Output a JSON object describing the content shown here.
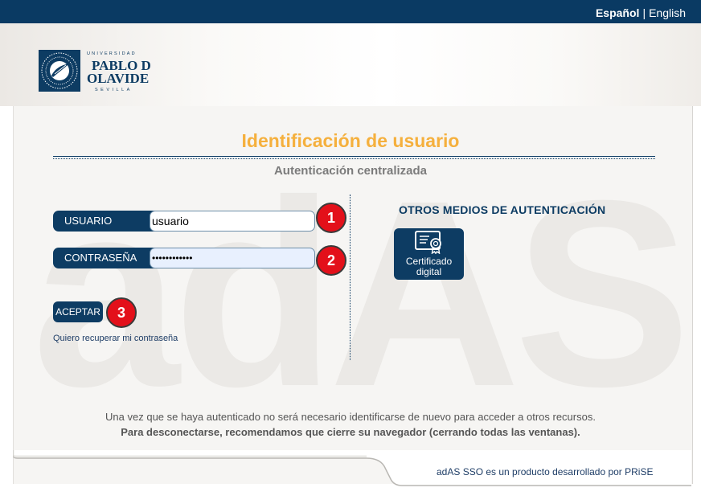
{
  "language": {
    "current": "Español",
    "separator": "|",
    "other": "English"
  },
  "brand": {
    "logo_icon": "university-seal-icon",
    "logo_top": "UNIVERSIDAD",
    "logo_name_1": "PABLO DE",
    "logo_name_2": "OLAVIDE",
    "logo_bottom": "SEVILLA"
  },
  "page": {
    "title": "Identificación de usuario",
    "subtitle": "Autenticación centralizada",
    "watermark": "adAS"
  },
  "login": {
    "user_label": "USUARIO",
    "user_value": "usuario",
    "pass_label": "CONTRASEÑA",
    "pass_value": "••••••••••••",
    "accept_label": "ACEPTAR",
    "recover_link": "Quiero recuperar mi contraseña"
  },
  "annotations": {
    "step1": "1",
    "step2": "2",
    "step3": "3",
    "color": "#e3101a"
  },
  "other_methods": {
    "title": "OTROS MEDIOS DE AUTENTICACIÓN",
    "cert_icon": "certificate-icon",
    "cert_label_1": "Certificado",
    "cert_label_2": "digital"
  },
  "info": {
    "line1": "Una vez que se haya autenticado no será necesario identificarse de nuevo para acceder a otros recursos.",
    "line2": "Para desconectarse, recomendamos que cierre su navegador (cerrando todas las ventanas)."
  },
  "footer": {
    "text": "adAS SSO es un producto desarrollado por PRiSE"
  },
  "colors": {
    "navy": "#0a3a63",
    "accent": "#f5b03d"
  }
}
